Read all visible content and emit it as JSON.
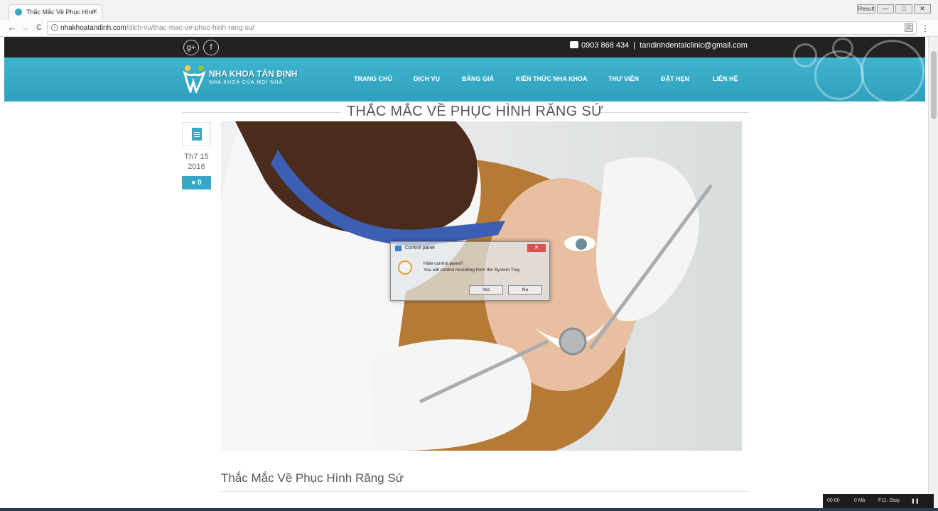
{
  "browser": {
    "tab_title": "Thắc Mắc Về Phục Hình",
    "tab_close": "×",
    "url_host": "nhakhoatandinh.com",
    "url_path": "/dich-vu/thac-mac-ve-phuc-hinh-rang-su/",
    "back": "←",
    "forward": "→",
    "reload": "C",
    "menu": "⋮",
    "window_controls": [
      "—",
      "□",
      "✕"
    ],
    "profile": "Result"
  },
  "site": {
    "social": [
      "g+",
      "f"
    ],
    "phone": "0903 868 434",
    "separator": "|",
    "email": "tandinhdentalclinic@gmail.com",
    "logo_title": "NHA KHOA TÂN ĐỊNH",
    "logo_sub": "NHA KHOA CỦA MỌI NHÀ",
    "nav": [
      "TRANG CHỦ",
      "DỊCH VỤ",
      "BẢNG GIÁ",
      "KIẾN THỨC NHA KHOA",
      "THƯ VIỆN",
      "ĐẶT HẸN",
      "LIÊN HỆ"
    ],
    "brand_color": "#3aaecb"
  },
  "post": {
    "title": "THẮC MẮC VỀ PHỤC HÌNH RĂNG SỨ",
    "date_line1": "Th7 15",
    "date_line2": "2016",
    "comments": "0",
    "article_title": "Thắc Mắc Về Phục Hình Răng Sứ"
  },
  "dialog": {
    "title": "Control panel",
    "close": "✕",
    "line1": "Hide control panel?",
    "line2": "You will control recording from the System Tray",
    "yes": "Yes",
    "no": "No"
  },
  "recorder": {
    "time": "00:00",
    "size": "0 Mb",
    "stop": "F11: Stop",
    "pause": "❚❚"
  }
}
